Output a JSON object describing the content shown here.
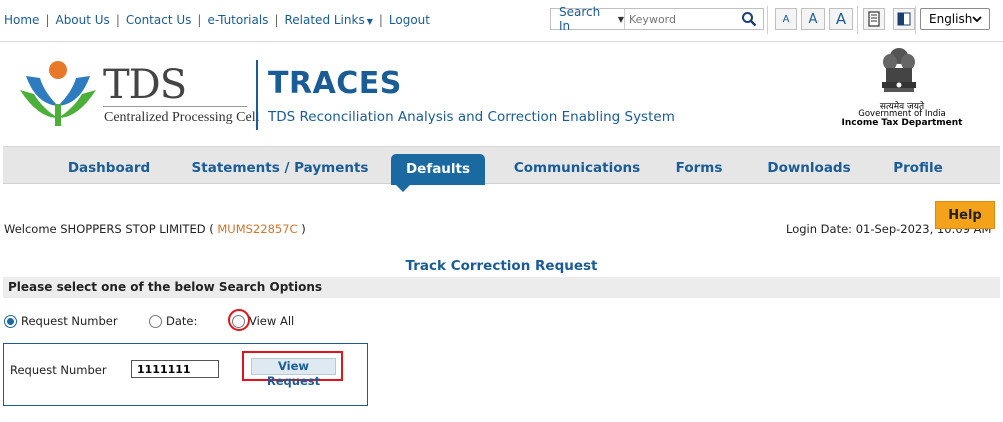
{
  "top_links": {
    "home": "Home",
    "about": "About Us",
    "contact": "Contact Us",
    "etutorials": "e-Tutorials",
    "related": "Related Links",
    "logout": "Logout",
    "separator": "|"
  },
  "search": {
    "search_in": "Search In",
    "placeholder": "Keyword"
  },
  "font_sizes": [
    "A",
    "A",
    "A"
  ],
  "language": "English",
  "logo": {
    "tds": "TDS",
    "cpc": "Centralized Processing Cell",
    "traces": "TRACES",
    "traces_full": "TDS Reconciliation Analysis and Correction Enabling System",
    "emblem_hindi": "सत्यमेव जयते",
    "emblem_gov": "Government of India",
    "emblem_dept": "Income Tax Department"
  },
  "nav": [
    "Dashboard",
    "Statements / Payments",
    "Defaults",
    "Communications",
    "Forms",
    "Downloads",
    "Profile"
  ],
  "nav_active": "Defaults",
  "welcome": {
    "prefix": "Welcome SHOPPERS STOP LIMITED ( ",
    "tan": "MUMS22857C",
    "suffix": " )",
    "login_date": "Login Date: 01-Sep-2023, 10:09 AM"
  },
  "help_label": "Help",
  "page_title": "Track Correction Request",
  "options_header": "Please select one of the below Search Options",
  "radio_options": {
    "request_number": "Request Number",
    "date": "Date:",
    "view_all": "View All",
    "selected": "Request Number"
  },
  "form": {
    "request_label": "Request Number",
    "request_value": "1111111",
    "view_button": "View Request"
  },
  "colors": {
    "brand_blue": "#1a5c96",
    "nav_active": "#1a6aa1",
    "help_orange": "#f3a21a",
    "highlight_red": "#e0141c",
    "tan_orange": "#d3742b"
  }
}
